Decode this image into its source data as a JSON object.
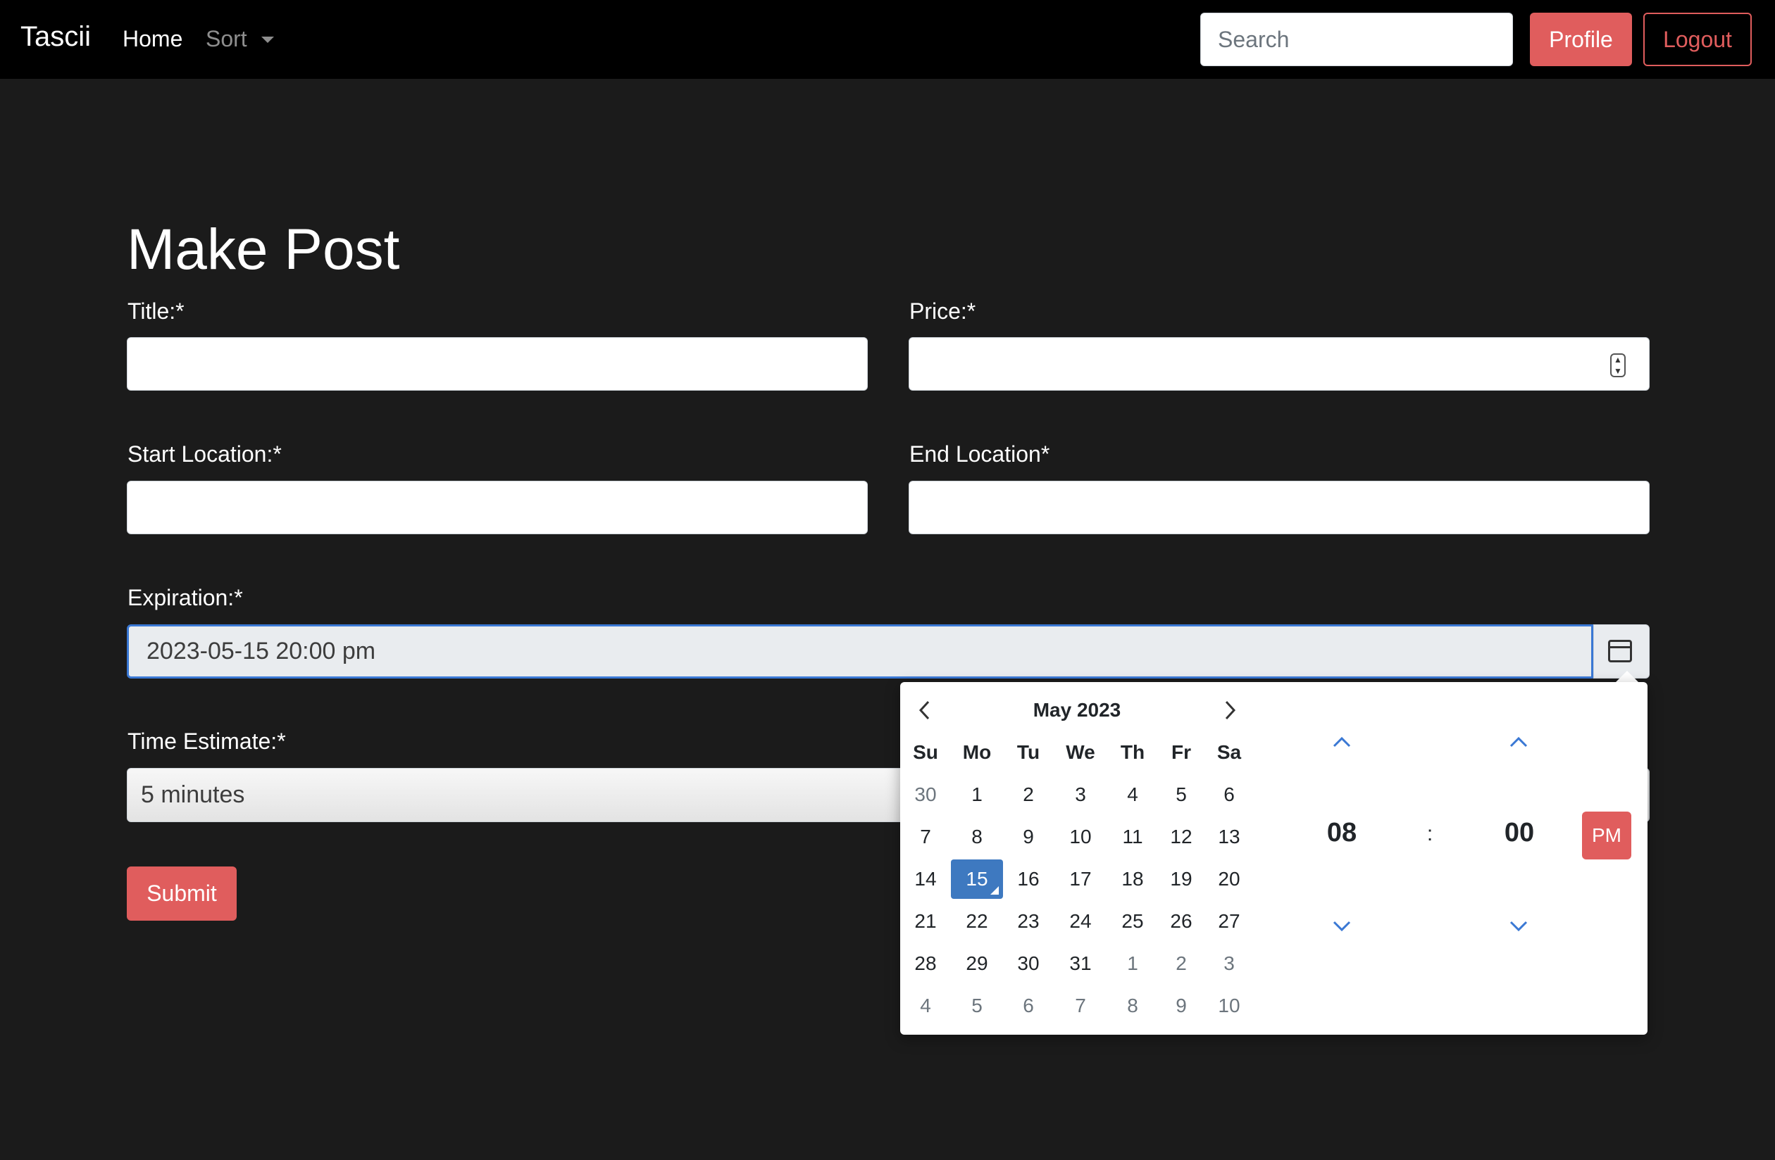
{
  "navbar": {
    "brand": "Tascii",
    "home": "Home",
    "sort": "Sort",
    "search_placeholder": "Search",
    "profile": "Profile",
    "logout": "Logout"
  },
  "form": {
    "title": "Make Post",
    "title_label": "Title:*",
    "price_label": "Price:*",
    "start_label": "Start Location:*",
    "end_label": "End Location*",
    "expiration_label": "Expiration:*",
    "expiration_value": "2023-05-15 20:00 pm",
    "time_estimate_label": "Time Estimate:*",
    "time_estimate_value": "5 minutes",
    "submit": "Submit"
  },
  "picker": {
    "month": "May 2023",
    "weekdays": [
      "Su",
      "Mo",
      "Tu",
      "We",
      "Th",
      "Fr",
      "Sa"
    ],
    "weeks": [
      [
        "30",
        "1",
        "2",
        "3",
        "4",
        "5",
        "6"
      ],
      [
        "7",
        "8",
        "9",
        "10",
        "11",
        "12",
        "13"
      ],
      [
        "14",
        "15",
        "16",
        "17",
        "18",
        "19",
        "20"
      ],
      [
        "21",
        "22",
        "23",
        "24",
        "25",
        "26",
        "27"
      ],
      [
        "28",
        "29",
        "30",
        "31",
        "1",
        "2",
        "3"
      ],
      [
        "4",
        "5",
        "6",
        "7",
        "8",
        "9",
        "10"
      ]
    ],
    "selected_day": "15",
    "hour": "08",
    "separator": ":",
    "minute": "00",
    "ampm": "PM"
  },
  "colors": {
    "accent": "#e05d5d",
    "selected": "#3e79c0",
    "navbar": "#000000",
    "background": "#1b1b1b"
  },
  "icons": {
    "calendar": "calendar-icon",
    "prev": "chevron-left-icon",
    "next": "chevron-right-icon",
    "up": "chevron-up-icon",
    "down": "chevron-down-icon",
    "sort_caret": "caret-down-icon"
  }
}
